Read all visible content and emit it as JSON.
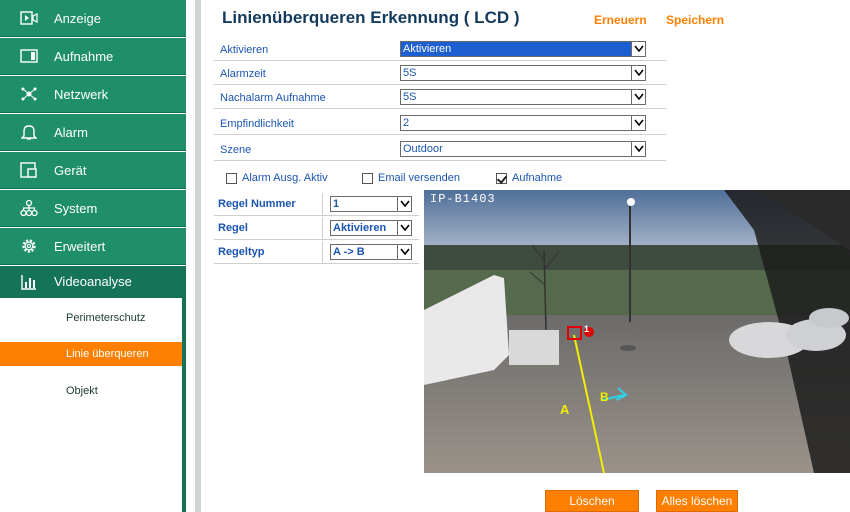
{
  "sidebar": {
    "items": [
      {
        "label": "Anzeige",
        "icon": "play-monitor-icon"
      },
      {
        "label": "Aufnahme",
        "icon": "folder-icon"
      },
      {
        "label": "Netzwerk",
        "icon": "network-icon"
      },
      {
        "label": "Alarm",
        "icon": "bell-icon"
      },
      {
        "label": "Gerät",
        "icon": "device-icon"
      },
      {
        "label": "System",
        "icon": "system-tree-icon"
      },
      {
        "label": "Erweitert",
        "icon": "gear-icon"
      },
      {
        "label": "Videoanalyse",
        "icon": "bar-chart-icon"
      }
    ],
    "subitems": [
      {
        "label": "Perimeterschutz"
      },
      {
        "label": "Linie überqueren"
      },
      {
        "label": "Objekt"
      }
    ]
  },
  "header": {
    "title": "Linienüberqueren Erkennung ( LCD )",
    "refresh_label": "Erneuern",
    "save_label": "Speichern"
  },
  "form": {
    "activate": {
      "label": "Aktivieren",
      "value": "Aktivieren"
    },
    "alarm_time": {
      "label": "Alarmzeit",
      "value": "5S"
    },
    "post_alarm": {
      "label": "Nachalarm Aufnahme",
      "value": "5S"
    },
    "sensitivity": {
      "label": "Empfindlichkeit",
      "value": "2"
    },
    "scene": {
      "label": "Szene",
      "value": "Outdoor"
    }
  },
  "checkboxes": {
    "alarm_output": {
      "label": "Alarm Ausg. Aktiv",
      "checked": false
    },
    "email": {
      "label": "Email versenden",
      "checked": false
    },
    "record": {
      "label": "Aufnahme",
      "checked": true
    }
  },
  "rules": {
    "number": {
      "label": "Regel Nummer",
      "value": "1"
    },
    "rule": {
      "label": "Regel",
      "value": "Aktivieren"
    },
    "type": {
      "label": "Regeltyp",
      "value": "A -> B"
    }
  },
  "video": {
    "camera_label": "IP-B1403",
    "point_marker": "1",
    "side_a": "A",
    "side_b": "B"
  },
  "buttons": {
    "delete_label": "Löschen",
    "delete_all_label": "Alles löschen"
  },
  "colors": {
    "sidebar": "#1f8f6a",
    "accent": "#ff7f00",
    "title": "#133a5c",
    "label": "#1a55b0"
  }
}
